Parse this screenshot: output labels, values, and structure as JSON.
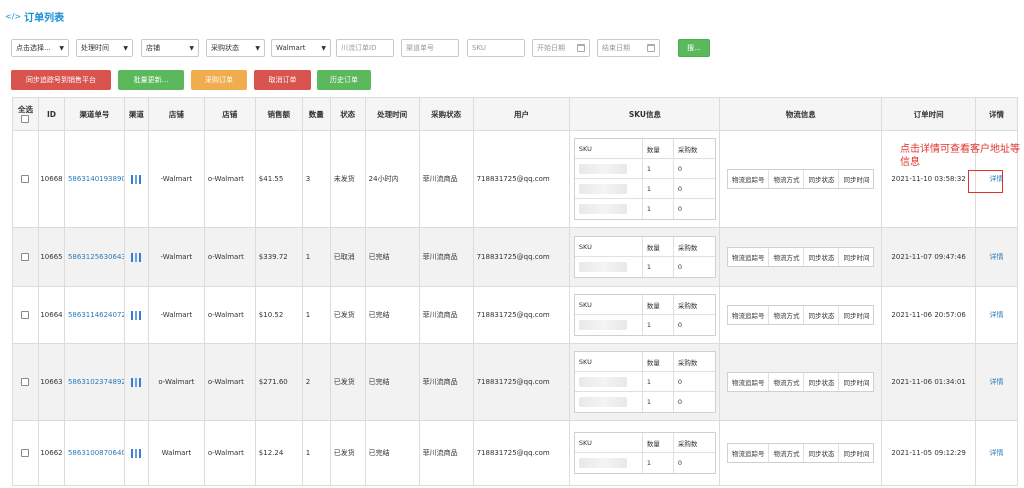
{
  "header": {
    "icon": "code-icon",
    "title": "订单列表",
    "code_glyph": "</>"
  },
  "filters": {
    "select1": "点击选择...",
    "select2": "处理时间",
    "select3": "店铺",
    "select4": "采购状态",
    "select5": "Walmart",
    "channel_order_placeholder": "川流订单ID",
    "channel_no_placeholder": "渠道单号",
    "sku_placeholder": "SKU",
    "start_date_placeholder": "开始日期",
    "end_date_placeholder": "结束日期",
    "search_label": "搜..."
  },
  "actions": {
    "sync_tracking": "同步追踪号到销售平台",
    "batch_update": "批量更新...",
    "purchase_order": "采购订单",
    "cancel_order": "取消订单",
    "history_order": "历史订单"
  },
  "table": {
    "headers": [
      "全选",
      "ID",
      "渠道单号",
      "渠道",
      "店铺",
      "店铺",
      "销售额",
      "数量",
      "状态",
      "处理时间",
      "采购状态",
      "用户",
      "SKU信息",
      "物流信息",
      "订单时间",
      "详情"
    ],
    "sku_headers": [
      "SKU",
      "数量",
      "采购数"
    ],
    "logistics_headers": [
      "物流追踪号",
      "物流方式",
      "同步状态",
      "同步时间"
    ],
    "detail_label": "详情",
    "rows": [
      {
        "id": "10668",
        "channel_no": "5863140193890",
        "store1": "-Walmart",
        "store2": "o-Walmart",
        "sales": "$41.55",
        "qty": "3",
        "status": "未发货",
        "process": "24小时内",
        "purchase": "菲川流商品",
        "user": "718831725@qq.com",
        "sku_items": [
          {
            "sku": "",
            "qty": "1",
            "pq": "0"
          },
          {
            "sku": "",
            "qty": "1",
            "pq": "0"
          },
          {
            "sku": "",
            "qty": "1",
            "pq": "0"
          }
        ],
        "order_time": "2021-11-10 03:58:32"
      },
      {
        "id": "10665",
        "channel_no": "5863125630643",
        "store1": "-Walmart",
        "store2": "o-Walmart",
        "sales": "$339.72",
        "qty": "1",
        "status": "已取消",
        "process": "已完结",
        "purchase": "菲川流商品",
        "user": "718831725@qq.com",
        "sku_items": [
          {
            "sku": "",
            "qty": "1",
            "pq": "0"
          }
        ],
        "order_time": "2021-11-07 09:47:46"
      },
      {
        "id": "10664",
        "channel_no": "5863114624072",
        "store1": "-Walmart",
        "store2": "o-Walmart",
        "sales": "$10.52",
        "qty": "1",
        "status": "已发货",
        "process": "已完结",
        "purchase": "菲川流商品",
        "user": "718831725@qq.com",
        "sku_items": [
          {
            "sku": "",
            "qty": "1",
            "pq": "0"
          }
        ],
        "order_time": "2021-11-06 20:57:06"
      },
      {
        "id": "10663",
        "channel_no": "5863102374892",
        "store1": "o-Walmart",
        "store2": "o-Walmart",
        "sales": "$271.60",
        "qty": "2",
        "status": "已发货",
        "process": "已完结",
        "purchase": "菲川流商品",
        "user": "718831725@qq.com",
        "sku_items": [
          {
            "sku": "",
            "qty": "1",
            "pq": "0"
          },
          {
            "sku": "",
            "qty": "1",
            "pq": "0"
          }
        ],
        "order_time": "2021-11-06 01:34:01"
      },
      {
        "id": "10662",
        "channel_no": "5863100870640",
        "store1": "Walmart",
        "store2": "o-Walmart",
        "sales": "$12.24",
        "qty": "1",
        "status": "已发货",
        "process": "已完结",
        "purchase": "菲川流商品",
        "user": "718831725@qq.com",
        "sku_items": [
          {
            "sku": "",
            "qty": "1",
            "pq": "0"
          }
        ],
        "order_time": "2021-11-05 09:12:29"
      }
    ]
  },
  "annotation": {
    "text": "点击详情可查看客户地址等信息"
  }
}
